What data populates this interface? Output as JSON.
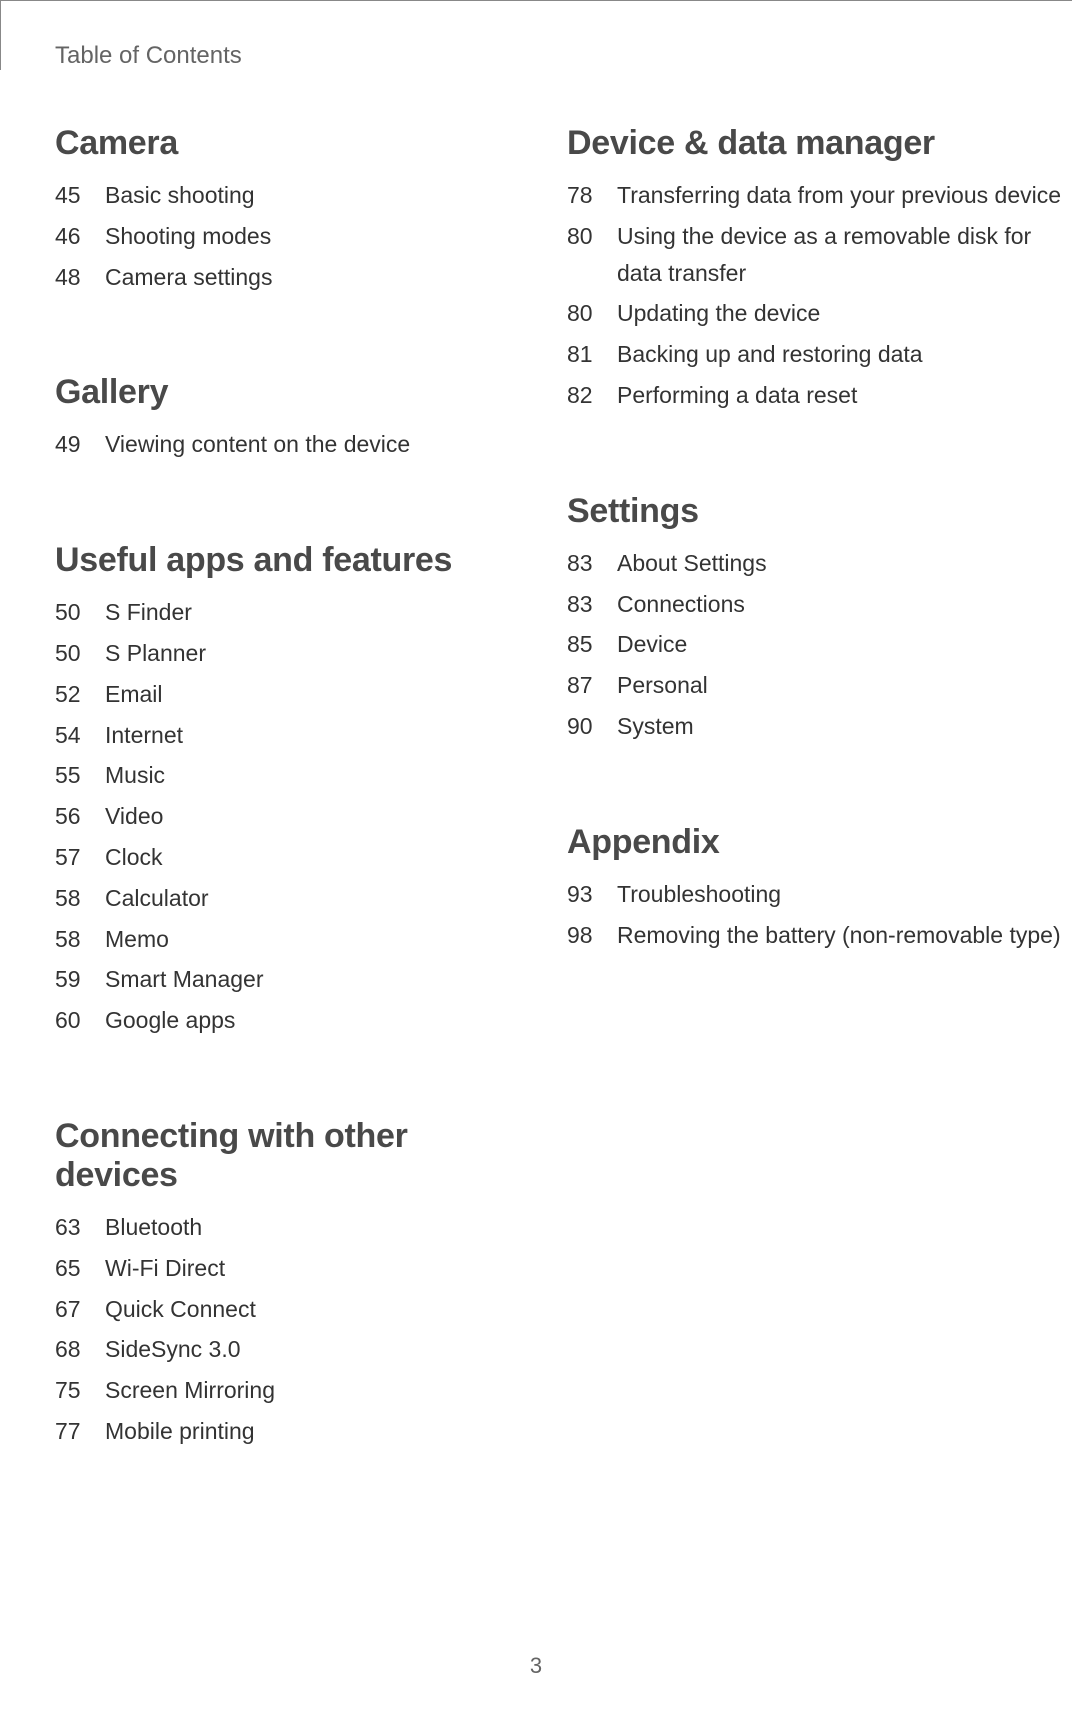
{
  "header": "Table of Contents",
  "page_number": "3",
  "left_sections": [
    {
      "title": "Camera",
      "entries": [
        {
          "page": "45",
          "title": "Basic shooting"
        },
        {
          "page": "46",
          "title": "Shooting modes"
        },
        {
          "page": "48",
          "title": "Camera settings"
        }
      ]
    },
    {
      "title": "Gallery",
      "entries": [
        {
          "page": "49",
          "title": "Viewing content on the device"
        }
      ]
    },
    {
      "title": "Useful apps and features",
      "entries": [
        {
          "page": "50",
          "title": "S Finder"
        },
        {
          "page": "50",
          "title": "S Planner"
        },
        {
          "page": "52",
          "title": "Email"
        },
        {
          "page": "54",
          "title": "Internet"
        },
        {
          "page": "55",
          "title": "Music"
        },
        {
          "page": "56",
          "title": "Video"
        },
        {
          "page": "57",
          "title": "Clock"
        },
        {
          "page": "58",
          "title": "Calculator"
        },
        {
          "page": "58",
          "title": "Memo"
        },
        {
          "page": "59",
          "title": "Smart Manager"
        },
        {
          "page": "60",
          "title": "Google apps"
        }
      ]
    },
    {
      "title": "Connecting with other devices",
      "entries": [
        {
          "page": "63",
          "title": "Bluetooth"
        },
        {
          "page": "65",
          "title": "Wi-Fi Direct"
        },
        {
          "page": "67",
          "title": "Quick Connect"
        },
        {
          "page": "68",
          "title": "SideSync 3.0"
        },
        {
          "page": "75",
          "title": "Screen Mirroring"
        },
        {
          "page": "77",
          "title": "Mobile printing"
        }
      ]
    }
  ],
  "right_sections": [
    {
      "title": "Device & data manager",
      "entries": [
        {
          "page": "78",
          "title": "Transferring data from your previous device"
        },
        {
          "page": "80",
          "title": "Using the device as a removable disk for data transfer"
        },
        {
          "page": "80",
          "title": "Updating the device"
        },
        {
          "page": "81",
          "title": "Backing up and restoring data"
        },
        {
          "page": "82",
          "title": "Performing a data reset"
        }
      ]
    },
    {
      "title": "Settings",
      "entries": [
        {
          "page": "83",
          "title": "About Settings"
        },
        {
          "page": "83",
          "title": "Connections"
        },
        {
          "page": "85",
          "title": "Device"
        },
        {
          "page": "87",
          "title": "Personal"
        },
        {
          "page": "90",
          "title": "System"
        }
      ]
    },
    {
      "title": "Appendix",
      "entries": [
        {
          "page": "93",
          "title": "Troubleshooting"
        },
        {
          "page": "98",
          "title": "Removing the battery (non-removable type)"
        }
      ]
    }
  ]
}
